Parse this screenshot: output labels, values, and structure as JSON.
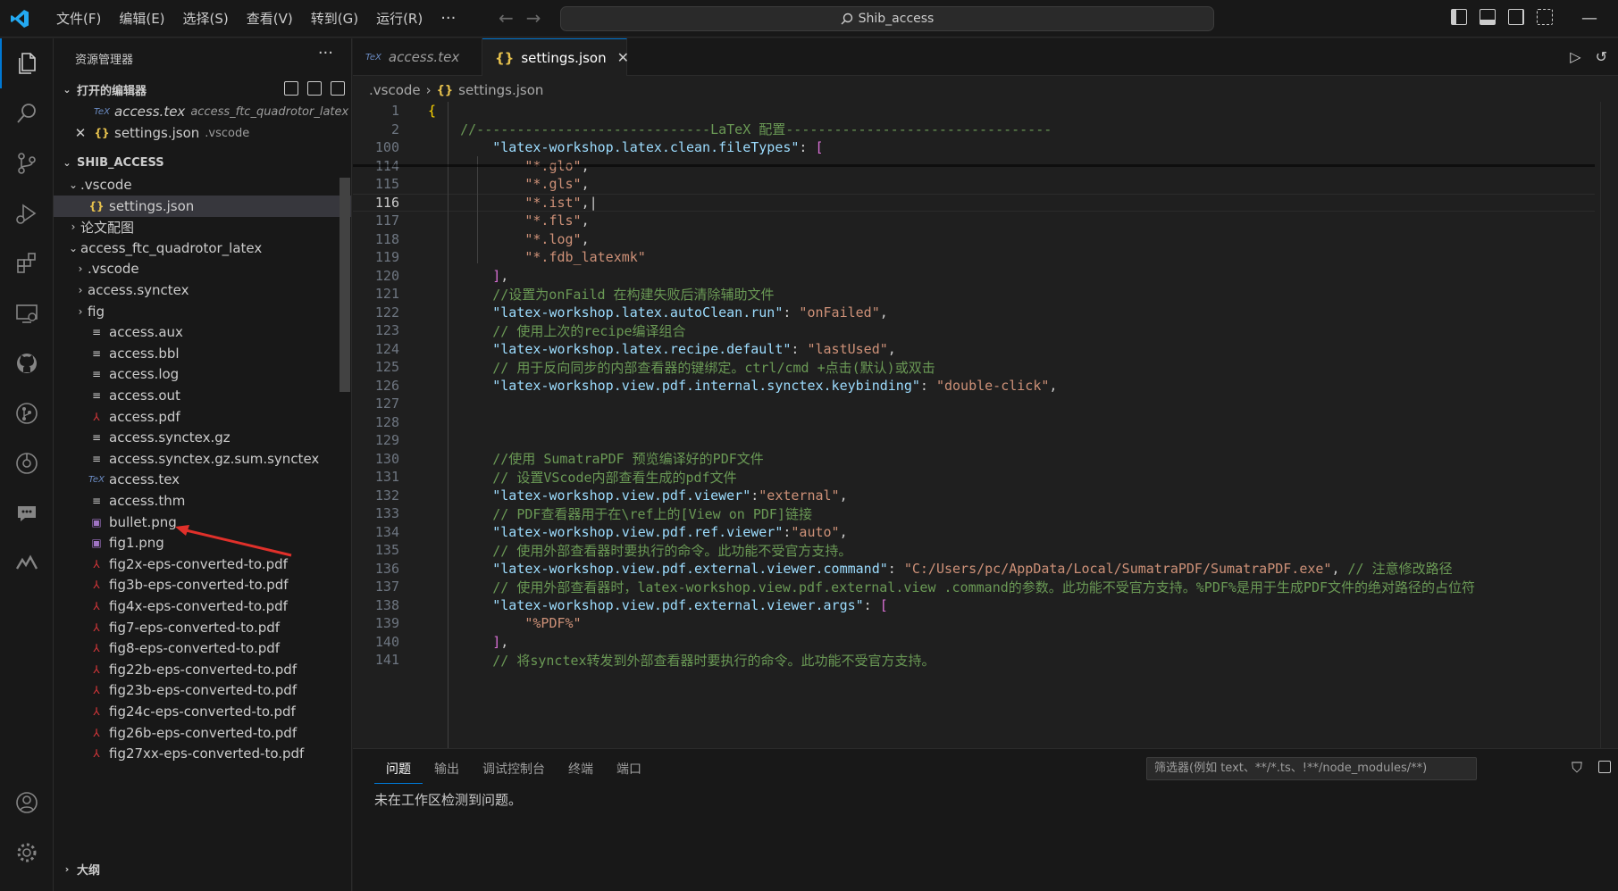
{
  "titlebar": {
    "menu": [
      "文件(F)",
      "编辑(E)",
      "选择(S)",
      "查看(V)",
      "转到(G)",
      "运行(R)"
    ],
    "more": "···",
    "search_text": "Shib_access",
    "icons": [
      "toggle-primary-sidebar-icon",
      "toggle-panel-icon",
      "toggle-secondary-sidebar-icon",
      "customize-layout-icon"
    ],
    "minimize": "—"
  },
  "activitybar": {
    "icons": [
      "explorer-icon",
      "search-icon",
      "source-control-icon",
      "run-debug-icon",
      "extensions-icon",
      "remote-explorer-icon",
      "github-icon",
      "git-graph-icon",
      "timeline-icon",
      "chat-icon",
      "latex-workshop-icon",
      "account-icon",
      "manage-gear-icon"
    ]
  },
  "sidebar": {
    "title": "资源管理器",
    "more": "···",
    "open_editors": {
      "label": "打开的编辑器",
      "items": [
        {
          "icon": "TeX",
          "name": "access.tex",
          "path": "access_ftc_quadrotor_latex"
        },
        {
          "icon": "{}",
          "name": "settings.json",
          "path": ".vscode"
        }
      ]
    },
    "workspace": {
      "label": "SHIB_ACCESS",
      "items": [
        {
          "depth": 1,
          "chev": "⌄",
          "icon": "",
          "name": ".vscode"
        },
        {
          "depth": 2,
          "chev": "",
          "icon": "{}",
          "name": "settings.json",
          "selected": true
        },
        {
          "depth": 1,
          "chev": "›",
          "icon": "",
          "name": "论文配图"
        },
        {
          "depth": 1,
          "chev": "⌄",
          "icon": "",
          "name": "access_ftc_quadrotor_latex"
        },
        {
          "depth": 2,
          "chev": "›",
          "icon": "",
          "name": ".vscode"
        },
        {
          "depth": 2,
          "chev": "›",
          "icon": "",
          "name": "access.synctex"
        },
        {
          "depth": 2,
          "chev": "›",
          "icon": "",
          "name": "fig"
        },
        {
          "depth": 2,
          "chev": "",
          "icon": "≡",
          "name": "access.aux"
        },
        {
          "depth": 2,
          "chev": "",
          "icon": "≡",
          "name": "access.bbl"
        },
        {
          "depth": 2,
          "chev": "",
          "icon": "≡",
          "name": "access.log"
        },
        {
          "depth": 2,
          "chev": "",
          "icon": "≡",
          "name": "access.out"
        },
        {
          "depth": 2,
          "chev": "",
          "icon": "pdf",
          "name": "access.pdf"
        },
        {
          "depth": 2,
          "chev": "",
          "icon": "≡",
          "name": "access.synctex.gz"
        },
        {
          "depth": 2,
          "chev": "",
          "icon": "≡",
          "name": "access.synctex.gz.sum.synctex"
        },
        {
          "depth": 2,
          "chev": "",
          "icon": "TeX",
          "name": "access.tex"
        },
        {
          "depth": 2,
          "chev": "",
          "icon": "≡",
          "name": "access.thm"
        },
        {
          "depth": 2,
          "chev": "",
          "icon": "png",
          "name": "bullet.png"
        },
        {
          "depth": 2,
          "chev": "",
          "icon": "png",
          "name": "fig1.png"
        },
        {
          "depth": 2,
          "chev": "",
          "icon": "pdf",
          "name": "fig2x-eps-converted-to.pdf"
        },
        {
          "depth": 2,
          "chev": "",
          "icon": "pdf",
          "name": "fig3b-eps-converted-to.pdf"
        },
        {
          "depth": 2,
          "chev": "",
          "icon": "pdf",
          "name": "fig4x-eps-converted-to.pdf"
        },
        {
          "depth": 2,
          "chev": "",
          "icon": "pdf",
          "name": "fig7-eps-converted-to.pdf"
        },
        {
          "depth": 2,
          "chev": "",
          "icon": "pdf",
          "name": "fig8-eps-converted-to.pdf"
        },
        {
          "depth": 2,
          "chev": "",
          "icon": "pdf",
          "name": "fig22b-eps-converted-to.pdf"
        },
        {
          "depth": 2,
          "chev": "",
          "icon": "pdf",
          "name": "fig23b-eps-converted-to.pdf"
        },
        {
          "depth": 2,
          "chev": "",
          "icon": "pdf",
          "name": "fig24c-eps-converted-to.pdf"
        },
        {
          "depth": 2,
          "chev": "",
          "icon": "pdf",
          "name": "fig26b-eps-converted-to.pdf"
        },
        {
          "depth": 2,
          "chev": "",
          "icon": "pdf",
          "name": "fig27xx-eps-converted-to.pdf"
        }
      ]
    },
    "outline_label": "大纲"
  },
  "tabs": [
    {
      "icon": "TeX",
      "label": "access.tex",
      "active": false
    },
    {
      "icon": "{}",
      "label": "settings.json",
      "active": true,
      "close": "✕"
    }
  ],
  "breadcrumb": {
    "folder": ".vscode",
    "sep": "›",
    "icon": "{}",
    "file": "settings.json"
  },
  "editor": {
    "current_line": "116",
    "lines": [
      {
        "n": "1",
        "tokens": [
          [
            "b1",
            "{"
          ]
        ]
      },
      {
        "n": "2",
        "tokens": [
          [
            "p",
            "    "
          ],
          [
            "c",
            "//-----------------------------LaTeX 配置---------------------------------"
          ]
        ]
      },
      {
        "n": "100",
        "tokens": [
          [
            "p",
            "        "
          ],
          [
            "k",
            "\"latex-workshop.latex.clean.fileTypes\""
          ],
          [
            "p",
            ": "
          ],
          [
            "b2",
            "["
          ]
        ]
      },
      {
        "n": "114",
        "tokens": [
          [
            "p",
            "            "
          ],
          [
            "s",
            "\"*.glo\""
          ],
          [
            "p",
            ","
          ]
        ]
      },
      {
        "n": "115",
        "tokens": [
          [
            "p",
            "            "
          ],
          [
            "s",
            "\"*.gls\""
          ],
          [
            "p",
            ","
          ]
        ]
      },
      {
        "n": "116",
        "tokens": [
          [
            "p",
            "            "
          ],
          [
            "s",
            "\"*.ist\""
          ],
          [
            "p",
            ",|"
          ]
        ]
      },
      {
        "n": "117",
        "tokens": [
          [
            "p",
            "            "
          ],
          [
            "s",
            "\"*.fls\""
          ],
          [
            "p",
            ","
          ]
        ]
      },
      {
        "n": "118",
        "tokens": [
          [
            "p",
            "            "
          ],
          [
            "s",
            "\"*.log\""
          ],
          [
            "p",
            ","
          ]
        ]
      },
      {
        "n": "119",
        "tokens": [
          [
            "p",
            "            "
          ],
          [
            "s",
            "\"*.fdb_latexmk\""
          ]
        ]
      },
      {
        "n": "120",
        "tokens": [
          [
            "p",
            "        "
          ],
          [
            "b2",
            "]"
          ],
          [
            "p",
            ","
          ]
        ]
      },
      {
        "n": "121",
        "tokens": [
          [
            "p",
            "        "
          ],
          [
            "c",
            "//设置为onFaild 在构建失败后清除辅助文件"
          ]
        ]
      },
      {
        "n": "122",
        "tokens": [
          [
            "p",
            "        "
          ],
          [
            "k",
            "\"latex-workshop.latex.autoClean.run\""
          ],
          [
            "p",
            ": "
          ],
          [
            "s",
            "\"onFailed\""
          ],
          [
            "p",
            ","
          ]
        ]
      },
      {
        "n": "123",
        "tokens": [
          [
            "p",
            "        "
          ],
          [
            "c",
            "// 使用上次的recipe编译组合"
          ]
        ]
      },
      {
        "n": "124",
        "tokens": [
          [
            "p",
            "        "
          ],
          [
            "k",
            "\"latex-workshop.latex.recipe.default\""
          ],
          [
            "p",
            ": "
          ],
          [
            "s",
            "\"lastUsed\""
          ],
          [
            "p",
            ","
          ]
        ]
      },
      {
        "n": "125",
        "tokens": [
          [
            "p",
            "        "
          ],
          [
            "c",
            "// 用于反向同步的内部查看器的键绑定。ctrl/cmd +点击(默认)或双击"
          ]
        ]
      },
      {
        "n": "126",
        "tokens": [
          [
            "p",
            "        "
          ],
          [
            "k",
            "\"latex-workshop.view.pdf.internal.synctex.keybinding\""
          ],
          [
            "p",
            ": "
          ],
          [
            "s",
            "\"double-click\""
          ],
          [
            "p",
            ","
          ]
        ]
      },
      {
        "n": "127",
        "tokens": []
      },
      {
        "n": "128",
        "tokens": []
      },
      {
        "n": "129",
        "tokens": []
      },
      {
        "n": "130",
        "tokens": [
          [
            "p",
            "        "
          ],
          [
            "c",
            "//使用 SumatraPDF 预览编译好的PDF文件"
          ]
        ]
      },
      {
        "n": "131",
        "tokens": [
          [
            "p",
            "        "
          ],
          [
            "c",
            "// 设置VScode内部查看生成的pdf文件"
          ]
        ]
      },
      {
        "n": "132",
        "tokens": [
          [
            "p",
            "        "
          ],
          [
            "k",
            "\"latex-workshop.view.pdf.viewer\""
          ],
          [
            "p",
            ":"
          ],
          [
            "s",
            "\"external\""
          ],
          [
            "p",
            ","
          ]
        ]
      },
      {
        "n": "133",
        "tokens": [
          [
            "p",
            "        "
          ],
          [
            "c",
            "// PDF查看器用于在\\ref上的[View on PDF]链接"
          ]
        ]
      },
      {
        "n": "134",
        "tokens": [
          [
            "p",
            "        "
          ],
          [
            "k",
            "\"latex-workshop.view.pdf.ref.viewer\""
          ],
          [
            "p",
            ":"
          ],
          [
            "s",
            "\"auto\""
          ],
          [
            "p",
            ","
          ]
        ]
      },
      {
        "n": "135",
        "tokens": [
          [
            "p",
            "        "
          ],
          [
            "c",
            "// 使用外部查看器时要执行的命令。此功能不受官方支持。"
          ]
        ]
      },
      {
        "n": "136",
        "tokens": [
          [
            "p",
            "        "
          ],
          [
            "k",
            "\"latex-workshop.view.pdf.external.viewer.command\""
          ],
          [
            "p",
            ": "
          ],
          [
            "s",
            "\"C:/Users/pc/AppData/Local/SumatraPDF/SumatraPDF.exe\""
          ],
          [
            "p",
            ", "
          ],
          [
            "c",
            "// 注意修改路径"
          ]
        ]
      },
      {
        "n": "137",
        "tokens": [
          [
            "p",
            "        "
          ],
          [
            "c",
            "// 使用外部查看器时，latex-workshop.view.pdf.external.view .command的参数。此功能不受官方支持。%PDF%是用于生成PDF文件的绝对路径的占位符"
          ]
        ]
      },
      {
        "n": "138",
        "tokens": [
          [
            "p",
            "        "
          ],
          [
            "k",
            "\"latex-workshop.view.pdf.external.viewer.args\""
          ],
          [
            "p",
            ": "
          ],
          [
            "b2",
            "["
          ]
        ]
      },
      {
        "n": "139",
        "tokens": [
          [
            "p",
            "            "
          ],
          [
            "s",
            "\"%PDF%\""
          ]
        ]
      },
      {
        "n": "140",
        "tokens": [
          [
            "p",
            "        "
          ],
          [
            "b2",
            "]"
          ],
          [
            "p",
            ","
          ]
        ]
      },
      {
        "n": "141",
        "tokens": [
          [
            "p",
            "        "
          ],
          [
            "c",
            "// 将synctex转发到外部查看器时要执行的命令。此功能不受官方支持。"
          ]
        ]
      }
    ]
  },
  "panel": {
    "tabs": [
      "问题",
      "输出",
      "调试控制台",
      "终端",
      "端口"
    ],
    "filter_placeholder": "筛选器(例如 text、**/*.ts、!**/node_modules/**)",
    "message": "未在工作区检测到问题。"
  },
  "colors": {
    "accent": "#0078d4",
    "annotation_arrow": "#e0302a"
  }
}
